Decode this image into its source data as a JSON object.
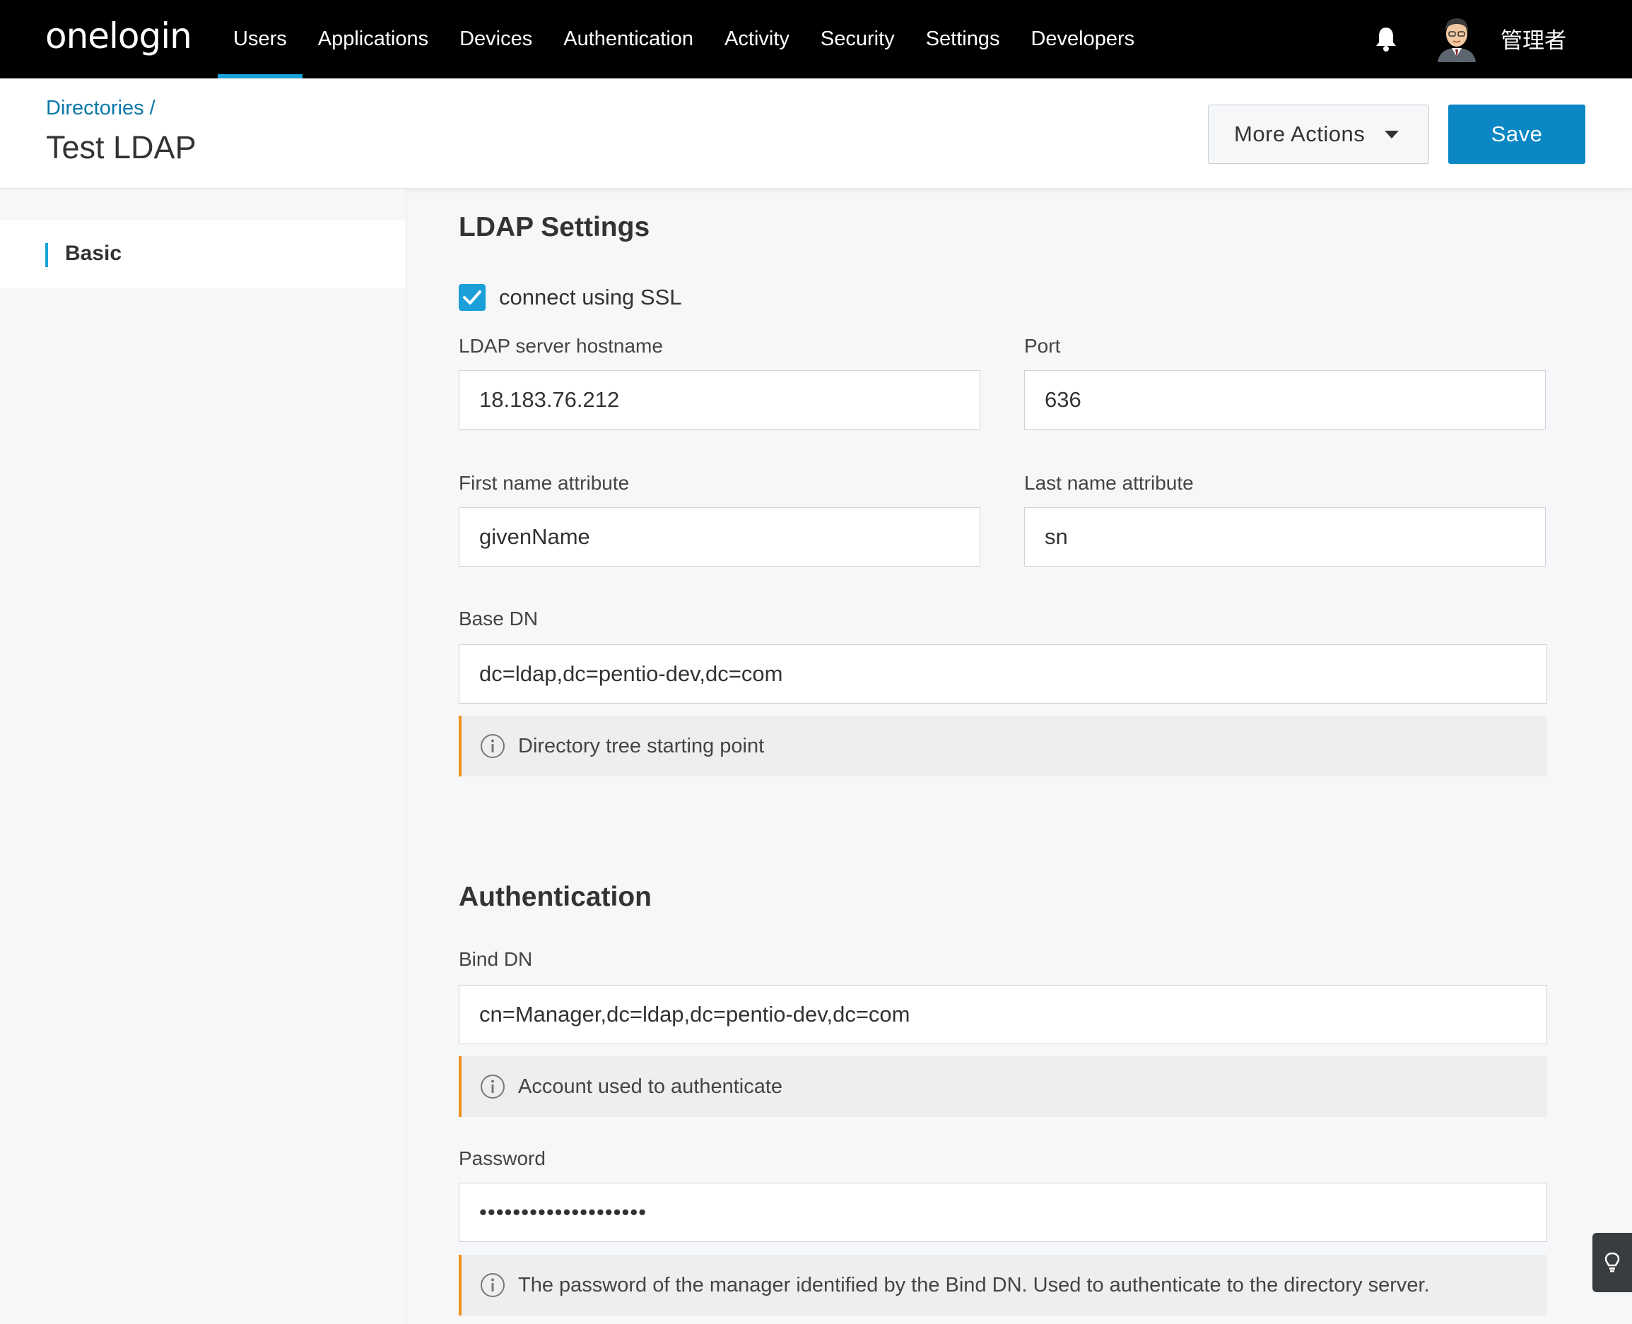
{
  "topnav": {
    "logo": "onelogin",
    "items": [
      "Users",
      "Applications",
      "Devices",
      "Authentication",
      "Activity",
      "Security",
      "Settings",
      "Developers"
    ],
    "active_index": 0,
    "user_name": "管理者"
  },
  "header": {
    "breadcrumb": "Directories /",
    "title": "Test LDAP",
    "more_actions_label": "More Actions",
    "save_label": "Save"
  },
  "sidebar": {
    "items": [
      {
        "label": "Basic",
        "active": true
      }
    ]
  },
  "ldap_settings": {
    "section_title": "LDAP Settings",
    "ssl_label": "connect using SSL",
    "ssl_checked": true,
    "hostname_label": "LDAP server hostname",
    "hostname_value": "18.183.76.212",
    "port_label": "Port",
    "port_value": "636",
    "first_name_label": "First name attribute",
    "first_name_value": "givenName",
    "last_name_label": "Last name attribute",
    "last_name_value": "sn",
    "base_dn_label": "Base DN",
    "base_dn_value": "dc=ldap,dc=pentio-dev,dc=com",
    "base_dn_hint": "Directory tree starting point"
  },
  "authentication": {
    "section_title": "Authentication",
    "bind_dn_label": "Bind DN",
    "bind_dn_value": "cn=Manager,dc=ldap,dc=pentio-dev,dc=com",
    "bind_dn_hint": "Account used to authenticate",
    "password_label": "Password",
    "password_value": "••••••••••••••••••••",
    "password_hint": "The password of the manager identified by the Bind DN. Used to authenticate to the directory server."
  },
  "colors": {
    "accent": "#1ba3d9",
    "save_button": "#0a87c4",
    "link": "#0b78a8",
    "hint_border": "#f0901e"
  }
}
